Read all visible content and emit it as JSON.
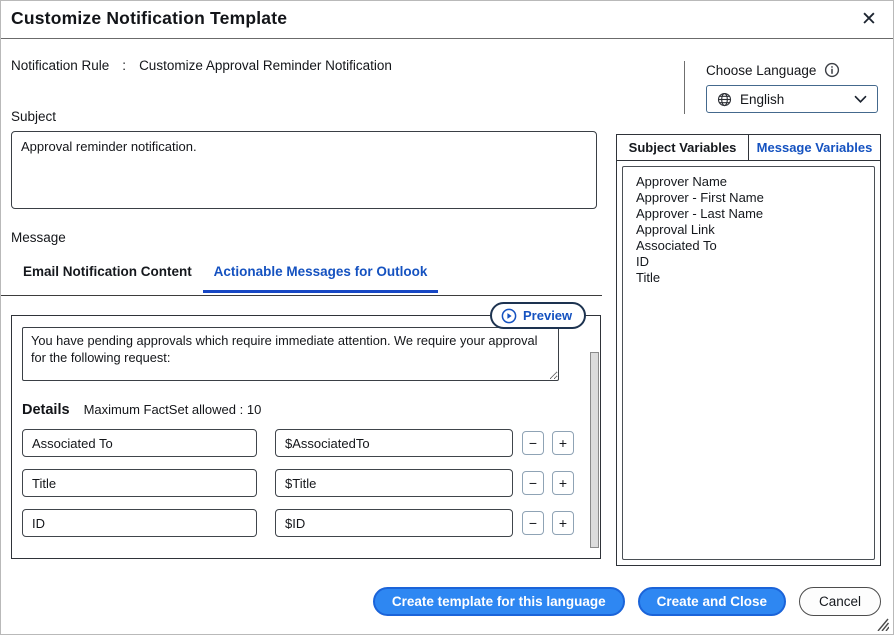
{
  "header": {
    "title": "Customize Notification Template",
    "close_glyph": "✕"
  },
  "rule": {
    "label": "Notification Rule",
    "separator": ":",
    "value": "Customize Approval Reminder Notification"
  },
  "language": {
    "label": "Choose Language",
    "selected": "English"
  },
  "subject": {
    "label": "Subject",
    "value": "Approval reminder notification."
  },
  "message": {
    "label": "Message",
    "tabs": [
      {
        "label": "Email Notification Content",
        "active": false
      },
      {
        "label": "Actionable Messages for Outlook",
        "active": true
      }
    ],
    "preview_label": "Preview",
    "body": "You have pending approvals which require immediate attention. We require your approval for the following request:",
    "details": {
      "label": "Details",
      "hint": "Maximum FactSet allowed : 10",
      "remove_glyph": "−",
      "add_glyph": "+",
      "rows": [
        {
          "label": "Associated To",
          "value": "$AssociatedTo"
        },
        {
          "label": "Title",
          "value": "$Title"
        },
        {
          "label": "ID",
          "value": "$ID"
        }
      ]
    }
  },
  "variables": {
    "tabs": [
      {
        "label": "Subject Variables",
        "active": false
      },
      {
        "label": "Message Variables",
        "active": true
      }
    ],
    "items": [
      "Approver Name",
      "Approver - First Name",
      "Approver - Last Name",
      "Approval Link",
      "Associated To",
      "ID",
      "Title"
    ]
  },
  "footer": {
    "buttons": [
      {
        "label": "Create template for this language",
        "style": "primary"
      },
      {
        "label": "Create and Close",
        "style": "primary"
      },
      {
        "label": "Cancel",
        "style": "secondary"
      }
    ]
  },
  "colors": {
    "accent_blue": "#1552c0",
    "tab_underline": "#1747c4",
    "button_fill": "#2e87f2",
    "button_border": "#1b64d9",
    "dropdown_border": "#44698d"
  }
}
